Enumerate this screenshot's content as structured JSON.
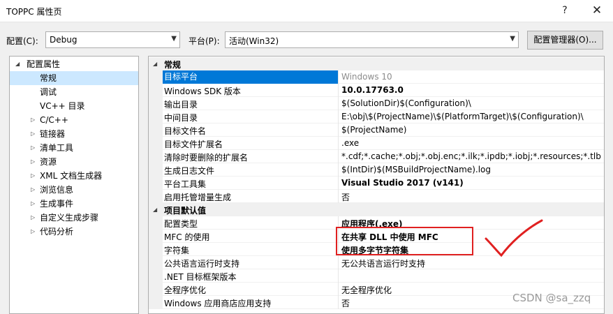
{
  "window": {
    "title": "TOPPC 属性页",
    "help_icon": "?",
    "close_icon": "✕"
  },
  "toolbar": {
    "config_label": "配置(C):",
    "config_value": "Debug",
    "platform_label": "平台(P):",
    "platform_value": "活动(Win32)",
    "manager_button": "配置管理器(O)..."
  },
  "tree": {
    "root": "配置属性",
    "items": [
      {
        "label": "常规",
        "expandable": false,
        "selected": true
      },
      {
        "label": "调试",
        "expandable": false
      },
      {
        "label": "VC++ 目录",
        "expandable": false
      },
      {
        "label": "C/C++",
        "expandable": true
      },
      {
        "label": "链接器",
        "expandable": true
      },
      {
        "label": "清单工具",
        "expandable": true
      },
      {
        "label": "资源",
        "expandable": true
      },
      {
        "label": "XML 文档生成器",
        "expandable": true
      },
      {
        "label": "浏览信息",
        "expandable": true
      },
      {
        "label": "生成事件",
        "expandable": true
      },
      {
        "label": "自定义生成步骤",
        "expandable": true
      },
      {
        "label": "代码分析",
        "expandable": true
      }
    ]
  },
  "grid": {
    "sections": [
      {
        "title": "常规",
        "rows": [
          {
            "name": "目标平台",
            "value": "Windows 10",
            "style": "grey",
            "selected": true
          },
          {
            "name": "Windows SDK 版本",
            "value": "10.0.17763.0",
            "style": "bold"
          },
          {
            "name": "输出目录",
            "value": "$(SolutionDir)$(Configuration)\\"
          },
          {
            "name": "中间目录",
            "value": "E:\\obj\\$(ProjectName)\\$(PlatformTarget)\\$(Configuration)\\"
          },
          {
            "name": "目标文件名",
            "value": "$(ProjectName)"
          },
          {
            "name": "目标文件扩展名",
            "value": ".exe"
          },
          {
            "name": "清除时要删除的扩展名",
            "value": "*.cdf;*.cache;*.obj;*.obj.enc;*.ilk;*.ipdb;*.iobj;*.resources;*.tlb;*.tli;*.t"
          },
          {
            "name": "生成日志文件",
            "value": "$(IntDir)$(MSBuildProjectName).log"
          },
          {
            "name": "平台工具集",
            "value": "Visual Studio 2017 (v141)",
            "style": "bold"
          },
          {
            "name": "启用托管增量生成",
            "value": "否"
          }
        ]
      },
      {
        "title": "项目默认值",
        "rows": [
          {
            "name": "配置类型",
            "value": "应用程序(.exe)",
            "style": "bold"
          },
          {
            "name": "MFC 的使用",
            "value": "在共享 DLL 中使用 MFC",
            "style": "bold"
          },
          {
            "name": "字符集",
            "value": "使用多字节字符集",
            "style": "bold"
          },
          {
            "name": "公共语言运行时支持",
            "value": "无公共语言运行时支持"
          },
          {
            "name": ".NET 目标框架版本",
            "value": ""
          },
          {
            "name": "全程序优化",
            "value": "无全程序优化"
          },
          {
            "name": "Windows 应用商店应用支持",
            "value": "否"
          }
        ]
      }
    ]
  },
  "watermark": "CSDN @sa_zzq",
  "colors": {
    "selection": "#0078d7",
    "tree_selection": "#cce8ff",
    "annotation": "#e02020"
  }
}
